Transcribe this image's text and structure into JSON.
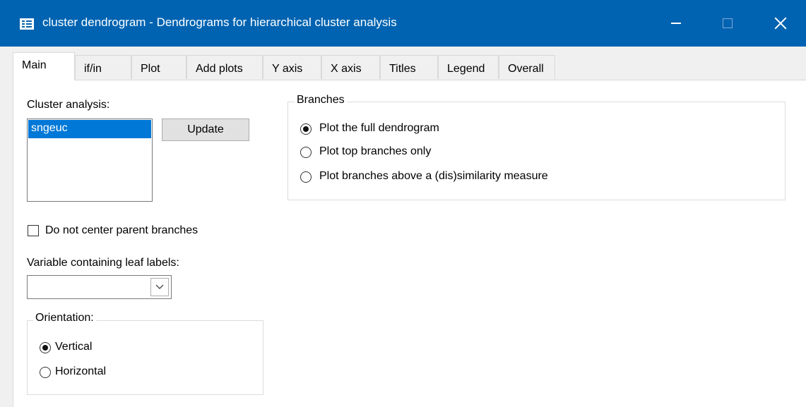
{
  "window": {
    "title": "cluster dendrogram - Dendrograms for hierarchical cluster analysis",
    "icon": "dialog-app-icon"
  },
  "tabs": [
    {
      "label": "Main",
      "active": true
    },
    {
      "label": "if/in",
      "active": false
    },
    {
      "label": "Plot",
      "active": false
    },
    {
      "label": "Add plots",
      "active": false
    },
    {
      "label": "Y axis",
      "active": false
    },
    {
      "label": "X axis",
      "active": false
    },
    {
      "label": "Titles",
      "active": false
    },
    {
      "label": "Legend",
      "active": false
    },
    {
      "label": "Overall",
      "active": false
    }
  ],
  "main": {
    "cluster_analysis": {
      "label": "Cluster analysis:",
      "items": [
        "sngeuc"
      ],
      "selected": "sngeuc",
      "update_label": "Update"
    },
    "center_parent": {
      "label": "Do not center parent branches",
      "checked": false
    },
    "leaf_labels": {
      "label": "Variable containing leaf labels:",
      "value": ""
    },
    "orientation": {
      "label": "Orientation:",
      "options": [
        {
          "label": "Vertical",
          "selected": true
        },
        {
          "label": "Horizontal",
          "selected": false
        }
      ]
    },
    "branches": {
      "label": "Branches",
      "options": [
        {
          "label": "Plot the full dendrogram",
          "selected": true
        },
        {
          "label": "Plot top branches only",
          "selected": false
        },
        {
          "label": "Plot branches above a (dis)similarity measure",
          "selected": false
        }
      ]
    }
  },
  "colors": {
    "titlebar": "#0063b1",
    "selection": "#0078d7",
    "panel": "#ffffff",
    "dialog": "#f0f0f0"
  }
}
